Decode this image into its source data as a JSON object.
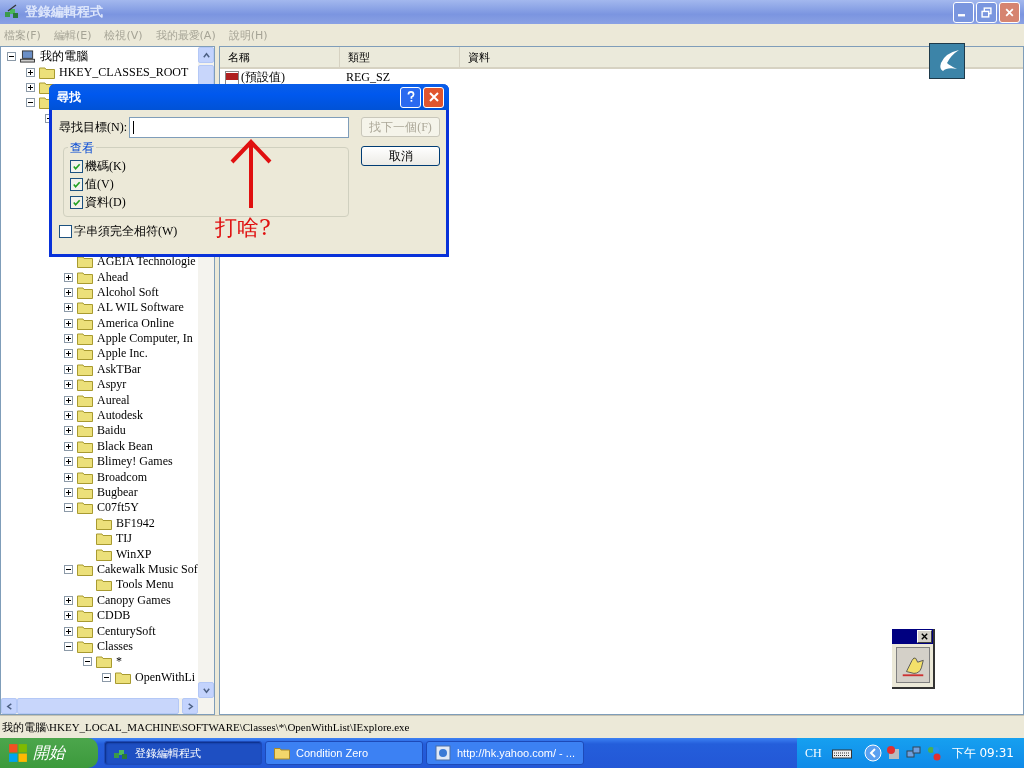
{
  "window": {
    "title": "登錄編輯程式"
  },
  "menu": [
    "檔案(F)",
    "編輯(E)",
    "檢視(V)",
    "我的最愛(A)",
    "說明(H)"
  ],
  "tree": [
    {
      "label": "我的電腦",
      "expanded": true,
      "children": [
        {
          "label": "HKEY_CLASSES_ROOT",
          "expanded": false
        },
        {
          "expanded": false
        },
        {
          "expanded": true,
          "children": [
            {
              "expanded": true,
              "children": [
                {
                  "label": "AGEIA Technologie"
                },
                {
                  "label": "Ahead",
                  "expanded": false
                },
                {
                  "label": "Alcohol Soft",
                  "expanded": false
                },
                {
                  "label": "AL WIL Software",
                  "expanded": false
                },
                {
                  "label": "America Online",
                  "expanded": false
                },
                {
                  "label": "Apple Computer, In",
                  "expanded": false
                },
                {
                  "label": "Apple Inc.",
                  "expanded": false
                },
                {
                  "label": "AskTBar",
                  "expanded": false
                },
                {
                  "label": "Aspyr",
                  "expanded": false
                },
                {
                  "label": "Aureal",
                  "expanded": false
                },
                {
                  "label": "Autodesk",
                  "expanded": false
                },
                {
                  "label": "Baidu",
                  "expanded": false
                },
                {
                  "label": "Black Bean",
                  "expanded": false
                },
                {
                  "label": "Blimey! Games",
                  "expanded": false
                },
                {
                  "label": "Broadcom",
                  "expanded": false
                },
                {
                  "label": "Bugbear",
                  "expanded": false
                },
                {
                  "label": "C07ft5Y",
                  "expanded": true,
                  "children": [
                    {
                      "label": "BF1942"
                    },
                    {
                      "label": "TIJ"
                    },
                    {
                      "label": "WinXP"
                    }
                  ]
                },
                {
                  "label": "Cakewalk Music Sof",
                  "expanded": true,
                  "children": [
                    {
                      "label": "Tools Menu"
                    }
                  ]
                },
                {
                  "label": "Canopy Games",
                  "expanded": false
                },
                {
                  "label": "CDDB",
                  "expanded": false
                },
                {
                  "label": "CenturySoft",
                  "expanded": false
                },
                {
                  "label": "Classes",
                  "expanded": true,
                  "children": [
                    {
                      "label": "*",
                      "expanded": true,
                      "children": [
                        {
                          "label": "OpenWithLi",
                          "expanded": true
                        }
                      ]
                    }
                  ]
                }
              ]
            }
          ]
        }
      ]
    }
  ],
  "list": {
    "columns": [
      "名稱",
      "類型",
      "資料"
    ],
    "rows": [
      {
        "name": "(預設值)",
        "type": "REG_SZ"
      }
    ]
  },
  "status_bar": "我的電腦\\HKEY_LOCAL_MACHINE\\SOFTWARE\\Classes\\*\\OpenWithList\\IExplore.exe",
  "find_dialog": {
    "title": "尋找",
    "find_label": "尋找目標(N):",
    "buttons": [
      {
        "label": "找下一個(F)",
        "disabled": true
      },
      {
        "label": "取消",
        "disabled": false
      }
    ],
    "group_title": "查看",
    "options": [
      {
        "label": "機碼(K)",
        "checked": true
      },
      {
        "label": "值(V)",
        "checked": true
      },
      {
        "label": "資料(D)",
        "checked": true
      }
    ],
    "match_whole": {
      "label": "字串須完全相符(W)",
      "checked": false
    }
  },
  "annotation": {
    "text": "打啥?"
  },
  "taskbar": {
    "start": "開始",
    "tasks": [
      {
        "label": "登錄編輯程式",
        "kind": "regedit",
        "selected": true
      },
      {
        "label": "Condition Zero",
        "kind": "folder",
        "selected": false
      },
      {
        "label": "http://hk.yahoo.com/ - ...",
        "kind": "browser",
        "selected": false
      }
    ],
    "language": "CH",
    "clock": "下午 09:31"
  }
}
